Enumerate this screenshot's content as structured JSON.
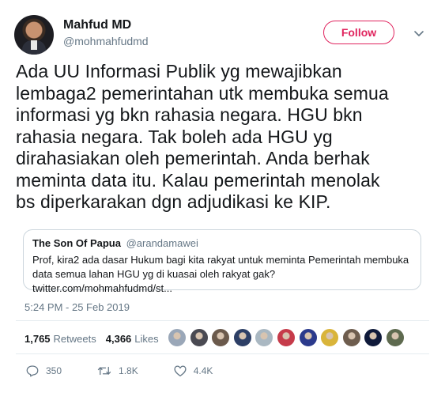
{
  "author": {
    "name": "Mahfud MD",
    "handle": "@mohmahfudmd"
  },
  "follow_label": "Follow",
  "tweet_text": "Ada UU Informasi Publik yg mewajibkan\nlembaga2 pemerintahan utk membuka semua\ninformasi yg bkn rahasia negara. HGU bkn\nrahasia negara. Tak boleh ada HGU yg\ndirahasiakan oleh pemerintah. Anda berhak\nmeminta data itu. Kalau pemerintah menolak\nbs diperkarakan dgn adjudikasi ke KIP.",
  "quoted": {
    "name": "The Son Of Papua",
    "handle": "@arandamawei",
    "text": "Prof, kira2 ada dasar Hukum bagi kita rakyat untuk meminta Pemerintah membuka\ndata semua lahan HGU yg di kuasai oleh rakyat gak? twitter.com/mohmahfudmd/st..."
  },
  "timestamp": "5:24 PM - 25 Feb 2019",
  "stats": {
    "retweets_count": "1,765",
    "retweets_label": "Retweets",
    "likes_count": "4,366",
    "likes_label": "Likes"
  },
  "likers": [
    {
      "color": "#9aa7b8"
    },
    {
      "color": "#4a4a52"
    },
    {
      "color": "#6b5a4c"
    },
    {
      "color": "#2d3f66"
    },
    {
      "color": "#aab8c2"
    },
    {
      "color": "#c63b4a"
    },
    {
      "color": "#2b3a8c"
    },
    {
      "color": "#d9b43a"
    },
    {
      "color": "#6e5d4e"
    },
    {
      "color": "#0f1a3a"
    },
    {
      "color": "#5e6a4f"
    }
  ],
  "actions": {
    "reply_count": "350",
    "retweet_count": "1.8K",
    "like_count": "4.4K"
  },
  "icons": {
    "caret": "chevron-down-icon",
    "reply": "reply-icon",
    "retweet": "retweet-icon",
    "like": "heart-icon"
  },
  "colors": {
    "follow": "#e0245e",
    "secondary_text": "#657786",
    "border": "#ccd6dd"
  }
}
